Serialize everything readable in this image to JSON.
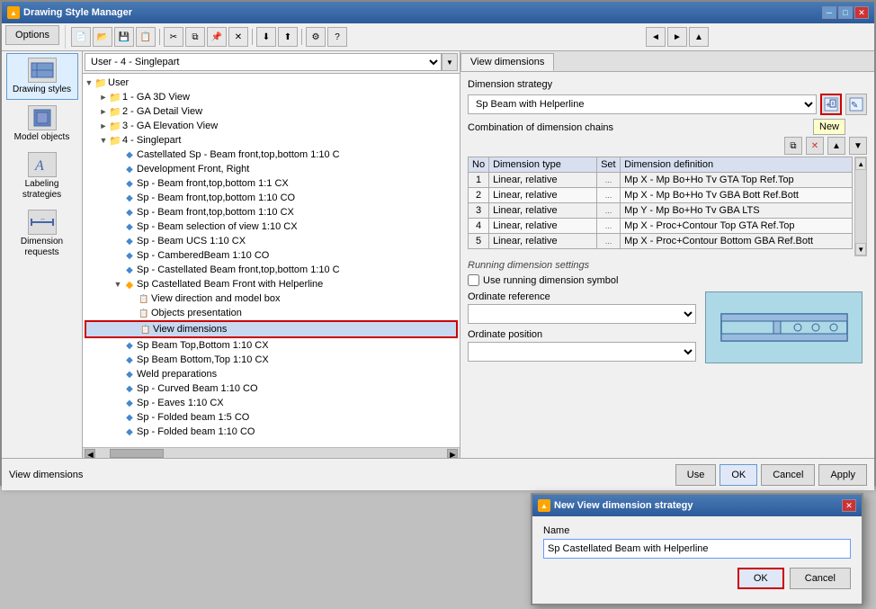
{
  "mainWindow": {
    "title": "Drawing Style Manager",
    "tabs": {
      "options": "Options"
    }
  },
  "sidebar": {
    "items": [
      {
        "id": "drawing-styles",
        "label": "Drawing styles",
        "icon": "🎨"
      },
      {
        "id": "model-objects",
        "label": "Model objects",
        "icon": "⬛"
      },
      {
        "id": "labeling-strategies",
        "label": "Labeling strategies",
        "icon": "A"
      },
      {
        "id": "dimension-requests",
        "label": "Dimension requests",
        "icon": "↔"
      }
    ]
  },
  "dropdown": {
    "value": "User - 4 - Singlepart"
  },
  "tree": {
    "items": [
      {
        "indent": 0,
        "expand": "▼",
        "type": "folder",
        "label": "User",
        "selected": false
      },
      {
        "indent": 1,
        "expand": "►",
        "type": "folder",
        "label": "1 - GA 3D View",
        "selected": false
      },
      {
        "indent": 1,
        "expand": "►",
        "type": "folder",
        "label": "2 - GA Detail View",
        "selected": false
      },
      {
        "indent": 1,
        "expand": "►",
        "type": "folder",
        "label": "3 - GA Elevation View",
        "selected": false
      },
      {
        "indent": 1,
        "expand": "▼",
        "type": "folder",
        "label": "4 - Singlepart",
        "selected": false
      },
      {
        "indent": 2,
        "expand": " ",
        "type": "item",
        "label": "Castellated Sp - Beam front,top,bottom 1:10 C",
        "selected": false
      },
      {
        "indent": 2,
        "expand": " ",
        "type": "item",
        "label": "Development Front, Right",
        "selected": false
      },
      {
        "indent": 2,
        "expand": " ",
        "type": "item",
        "label": "Sp - Beam front,top,bottom 1:1 CX",
        "selected": false
      },
      {
        "indent": 2,
        "expand": " ",
        "type": "item",
        "label": "Sp - Beam front,top,bottom 1:10 CO",
        "selected": false
      },
      {
        "indent": 2,
        "expand": " ",
        "type": "item",
        "label": "Sp - Beam front,top,bottom 1:10 CX",
        "selected": false
      },
      {
        "indent": 2,
        "expand": " ",
        "type": "item",
        "label": "Sp - Beam selection of view 1:10 CX",
        "selected": false
      },
      {
        "indent": 2,
        "expand": " ",
        "type": "item",
        "label": "Sp - Beam UCS 1:10 CX",
        "selected": false
      },
      {
        "indent": 2,
        "expand": " ",
        "type": "item",
        "label": "Sp - CamberedBeam 1:10 CO",
        "selected": false
      },
      {
        "indent": 2,
        "expand": " ",
        "type": "item",
        "label": "Sp - Castellated Beam front,top,bottom 1:10 C",
        "selected": false
      },
      {
        "indent": 2,
        "expand": "▼",
        "type": "folder",
        "label": "Sp Castellated Beam Front with Helperline",
        "selected": false
      },
      {
        "indent": 3,
        "expand": " ",
        "type": "item",
        "label": "View direction and model box",
        "selected": false
      },
      {
        "indent": 3,
        "expand": " ",
        "type": "item",
        "label": "Objects presentation",
        "selected": false
      },
      {
        "indent": 3,
        "expand": " ",
        "type": "item",
        "label": "View dimensions",
        "selected": true,
        "highlighted": true
      },
      {
        "indent": 2,
        "expand": " ",
        "type": "item",
        "label": "Sp Beam Top,Bottom 1:10 CX",
        "selected": false
      },
      {
        "indent": 2,
        "expand": " ",
        "type": "item",
        "label": "Sp Beam Bottom,Top 1:10 CX",
        "selected": false
      },
      {
        "indent": 2,
        "expand": " ",
        "type": "item",
        "label": "Weld preparations",
        "selected": false
      },
      {
        "indent": 2,
        "expand": " ",
        "type": "item",
        "label": "Sp - Curved Beam 1:10 CO",
        "selected": false
      },
      {
        "indent": 2,
        "expand": " ",
        "type": "item",
        "label": "Sp - Eaves 1:10 CX",
        "selected": false
      },
      {
        "indent": 2,
        "expand": " ",
        "type": "item",
        "label": "Sp - Folded beam 1:5 CO",
        "selected": false
      },
      {
        "indent": 2,
        "expand": " ",
        "type": "item",
        "label": "Sp - Folded beam 1:10 CO",
        "selected": false
      }
    ]
  },
  "rightPanel": {
    "tab": "View dimensions",
    "dimensionStrategy": {
      "label": "Dimension strategy",
      "value": "Sp Beam with Helperline",
      "newTooltip": "New"
    },
    "combinationLabel": "Combination of dimension chains",
    "tableHeaders": [
      "No",
      "Dimension type",
      "Set",
      "Dimension definition"
    ],
    "tableRows": [
      {
        "no": "1",
        "type": "Linear, relative",
        "set": "...",
        "def": "Mp X - Mp Bo+Ho Tv GTA Top Ref.Top"
      },
      {
        "no": "2",
        "type": "Linear, relative",
        "set": "...",
        "def": "Mp X - Mp Bo+Ho Tv GBA Bott Ref.Bott"
      },
      {
        "no": "3",
        "type": "Linear, relative",
        "set": "...",
        "def": "Mp Y - Mp Bo+Ho Tv GBA LTS"
      },
      {
        "no": "4",
        "type": "Linear, relative",
        "set": "...",
        "def": "Mp X - Proc+Contour Top GTA Ref.Top"
      },
      {
        "no": "5",
        "type": "Linear, relative",
        "set": "...",
        "def": "Mp X - Proc+Contour Bottom GBA Ref.Bott"
      }
    ],
    "runningSettings": {
      "title": "Running dimension settings",
      "useSymbol": "Use running dimension symbol",
      "ordinateRef": "Ordinate reference",
      "ordinatePos": "Ordinate position"
    }
  },
  "bottomButtons": {
    "use": "Use",
    "ok": "OK",
    "cancel": "Cancel",
    "apply": "Apply"
  },
  "statusBar": {
    "text": "View dimensions"
  },
  "dialog": {
    "title": "New View dimension strategy",
    "nameLabel": "Name",
    "nameValue": "Sp Castellated Beam with Helperline",
    "ok": "OK",
    "cancel": "Cancel"
  },
  "toolbar": {
    "buttons": [
      "new-file",
      "open",
      "save",
      "print",
      "cut",
      "copy",
      "paste",
      "delete",
      "undo",
      "redo",
      "help"
    ],
    "navBack": "◄",
    "navFwd": "►",
    "navUp": "▲"
  }
}
